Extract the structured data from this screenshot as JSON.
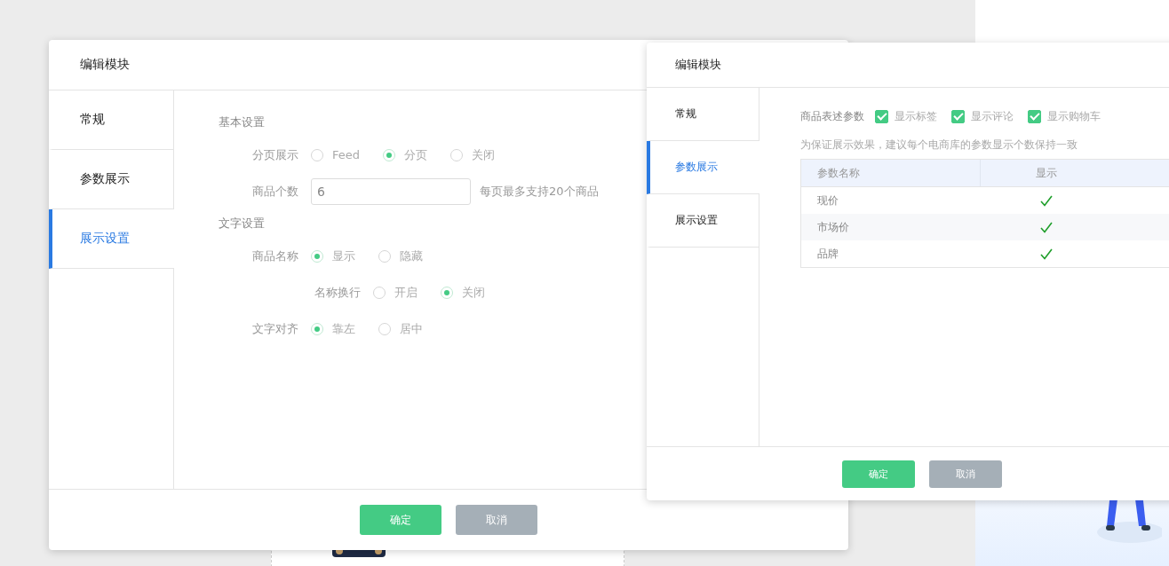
{
  "dialogs": [
    {
      "kind": "form",
      "title": "编辑模块",
      "tabs": [
        {
          "label": "常规",
          "selected": false
        },
        {
          "label": "参数展示",
          "selected": false
        },
        {
          "label": "展示设置",
          "selected": true
        }
      ],
      "sections": [
        {
          "title": "基本设置",
          "rows": [
            {
              "kind": "radio",
              "label": "分页展示",
              "options": [
                {
                  "label": "Feed",
                  "selected": false
                },
                {
                  "label": "分页",
                  "selected": true
                },
                {
                  "label": "关闭",
                  "selected": false
                }
              ]
            },
            {
              "kind": "input",
              "label": "商品个数",
              "value": "6",
              "hint": "每页最多支持20个商品"
            }
          ]
        },
        {
          "title": "文字设置",
          "rows": [
            {
              "kind": "radio",
              "label": "商品名称",
              "options": [
                {
                  "label": "显示",
                  "selected": true
                },
                {
                  "label": "隐藏",
                  "selected": false
                }
              ],
              "children": [
                {
                  "kind": "radio",
                  "label": "名称换行",
                  "options": [
                    {
                      "label": "开启",
                      "selected": false
                    },
                    {
                      "label": "关闭",
                      "selected": true
                    }
                  ]
                }
              ]
            },
            {
              "kind": "radio",
              "label": "文字对齐",
              "options": [
                {
                  "label": "靠左",
                  "selected": true
                },
                {
                  "label": "居中",
                  "selected": false
                }
              ]
            }
          ]
        }
      ],
      "buttons": [
        {
          "label": "确定",
          "kind": "primary"
        },
        {
          "label": "取消",
          "kind": "secondary"
        }
      ]
    },
    {
      "kind": "params",
      "title": "编辑模块",
      "tabs": [
        {
          "label": "常规",
          "selected": false
        },
        {
          "label": "参数展示",
          "selected": true
        },
        {
          "label": "展示设置",
          "selected": false
        }
      ],
      "checks": {
        "label": "商品表述参数",
        "options": [
          {
            "label": "显示标签",
            "checked": true
          },
          {
            "label": "显示评论",
            "checked": true
          },
          {
            "label": "显示购物车",
            "checked": true
          }
        ]
      },
      "note": "为保证展示效果，建议每个电商库的参数显示个数保持一致",
      "table": {
        "columns": [
          "参数名称",
          "显示"
        ],
        "rows": [
          {
            "name": "现价",
            "shown": true
          },
          {
            "name": "市场价",
            "shown": true
          },
          {
            "name": "品牌",
            "shown": true
          }
        ]
      },
      "buttons": [
        {
          "label": "确定",
          "kind": "primary"
        },
        {
          "label": "取消",
          "kind": "secondary"
        }
      ]
    }
  ]
}
